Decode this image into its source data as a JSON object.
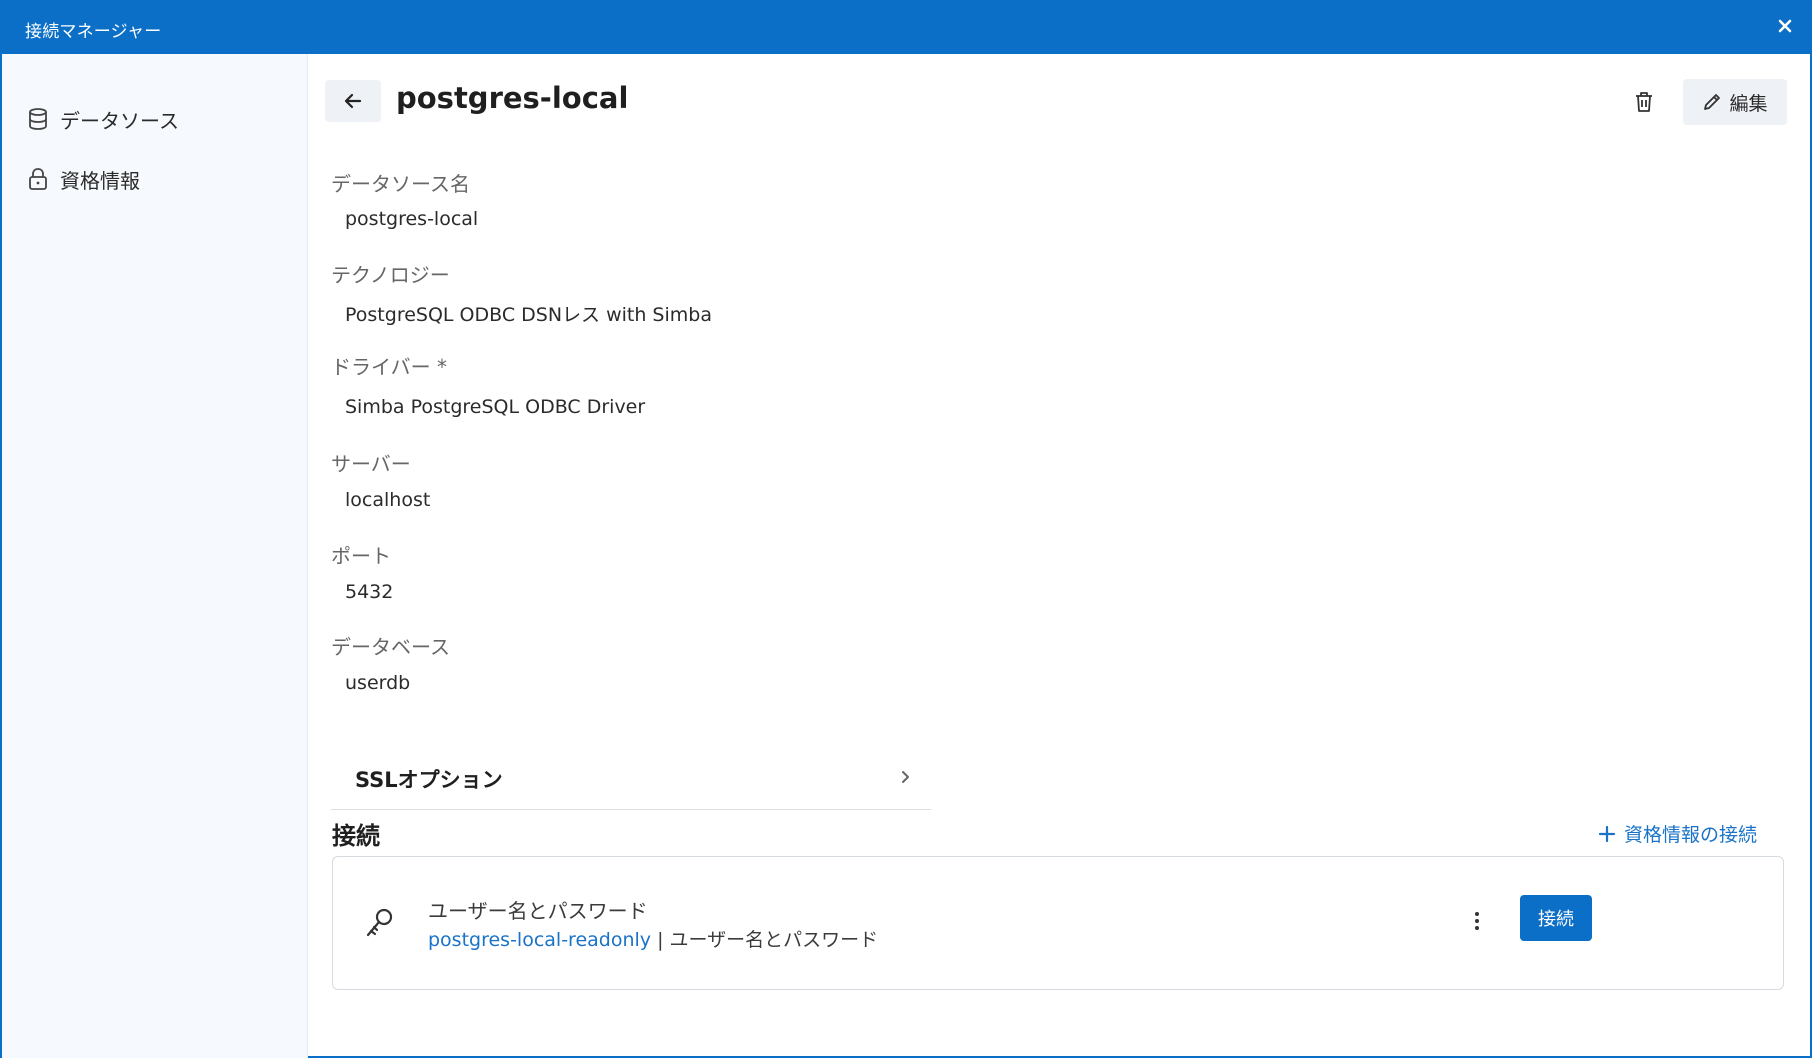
{
  "window": {
    "title": "接続マネージャー"
  },
  "sidebar": {
    "items": [
      {
        "label": "データソース",
        "icon": "database-icon"
      },
      {
        "label": "資格情報",
        "icon": "lock-icon"
      }
    ]
  },
  "header": {
    "title": "postgres-local",
    "edit_label": "編集"
  },
  "fields": [
    {
      "label": "データソース名",
      "value": "postgres-local"
    },
    {
      "label": "テクノロジー",
      "value": "PostgreSQL ODBC DSNレス with Simba"
    },
    {
      "label": "ドライバー *",
      "value": "Simba PostgreSQL ODBC Driver"
    },
    {
      "label": "サーバー",
      "value": "localhost"
    },
    {
      "label": "ポート",
      "value": "5432"
    },
    {
      "label": "データベース",
      "value": "userdb"
    }
  ],
  "ssl": {
    "label": "SSLオプション"
  },
  "connections": {
    "title": "接続",
    "add_label": "資格情報の接続",
    "card": {
      "title": "ユーザー名とパスワード",
      "link": "postgres-local-readonly",
      "separator": " | ",
      "subtitle": "ユーザー名とパスワード",
      "connect_label": "接続"
    }
  },
  "colors": {
    "accent": "#0b6fc7",
    "link": "#1a73c8"
  }
}
